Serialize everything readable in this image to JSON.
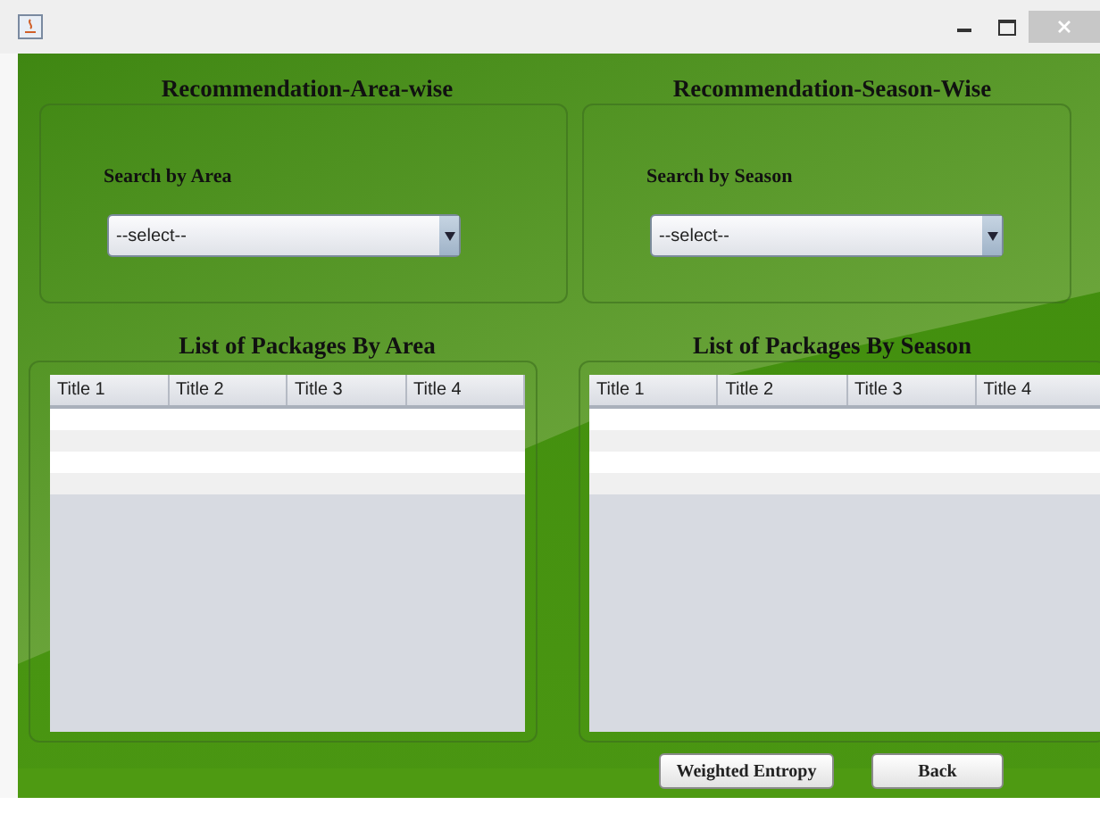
{
  "recommendation_panels": [
    {
      "title": "Recommendation-Area-wise",
      "label": "Search by Area",
      "dropdown": {
        "value": "--select--"
      }
    },
    {
      "title": "Recommendation-Season-Wise",
      "label": "Search by Season",
      "dropdown": {
        "value": "--select--"
      }
    }
  ],
  "package_lists": [
    {
      "title": "List of Packages By Area",
      "table": {
        "columns": [
          "Title 1",
          "Title 2",
          "Title 3",
          "Title 4"
        ]
      }
    },
    {
      "title": "List of Packages By Season",
      "table": {
        "columns": [
          "Title 1",
          "Title 2",
          "Title 3",
          "Title 4"
        ]
      }
    }
  ],
  "buttons": [
    "Weighted Entropy",
    "Back"
  ]
}
